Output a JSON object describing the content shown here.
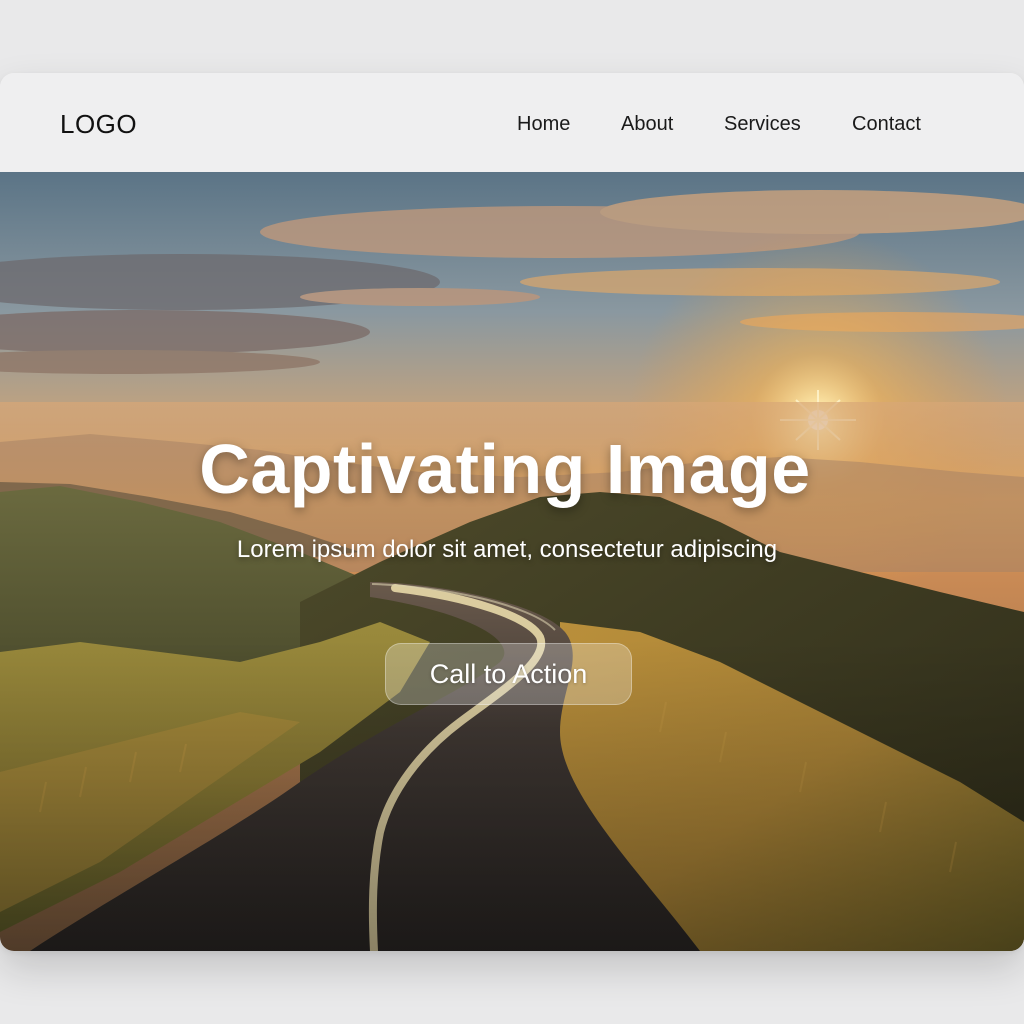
{
  "navbar": {
    "logo": "LOGO",
    "links": [
      {
        "label": "Home"
      },
      {
        "label": "About"
      },
      {
        "label": "Services"
      },
      {
        "label": "Contact"
      }
    ]
  },
  "hero": {
    "title": "Captivating Image",
    "subtitle": "Lorem ipsum dolor sit amet, consectetur adipiscing",
    "cta_label": "Call to Action",
    "background": "sunset-mountain-road-photo"
  },
  "colors": {
    "page_background": "#e9e9ea",
    "navbar_background": "#efeff0",
    "hero_text": "#ffffff"
  }
}
